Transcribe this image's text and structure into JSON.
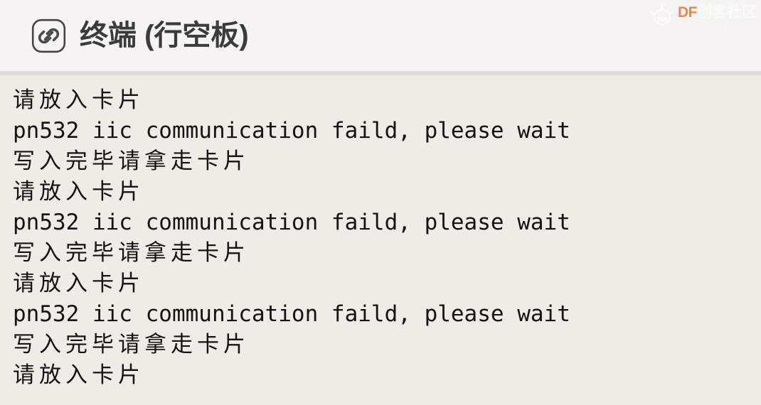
{
  "header": {
    "icon": "link-icon",
    "title": "终端 (行空板)",
    "background_color": "#f5f4f2",
    "title_color": "#3b3b3b",
    "divider_color": "#dbdbdb"
  },
  "watermark": {
    "mark_icon": "dfrobot-hexagon-logo-icon",
    "brand_latin": "DF",
    "brand_cjk": "创客社区",
    "url": "mc.DFRobot.com.cn",
    "brand_latin_color": "#e8834a",
    "brand_cjk_color": "#fbfbfa"
  },
  "terminal": {
    "background_color": "#efece5",
    "text_color": "#141414",
    "lines": [
      {
        "text": "请放入卡片",
        "script": "cjk"
      },
      {
        "text": "pn532 iic communication faild, please wait",
        "script": "latin"
      },
      {
        "text": "写入完毕请拿走卡片",
        "script": "cjk"
      },
      {
        "text": "请放入卡片",
        "script": "cjk"
      },
      {
        "text": "pn532 iic communication faild, please wait",
        "script": "latin"
      },
      {
        "text": "写入完毕请拿走卡片",
        "script": "cjk"
      },
      {
        "text": "请放入卡片",
        "script": "cjk"
      },
      {
        "text": "pn532 iic communication faild, please wait",
        "script": "latin"
      },
      {
        "text": "写入完毕请拿走卡片",
        "script": "cjk"
      },
      {
        "text": "请放入卡片",
        "script": "cjk"
      }
    ]
  }
}
